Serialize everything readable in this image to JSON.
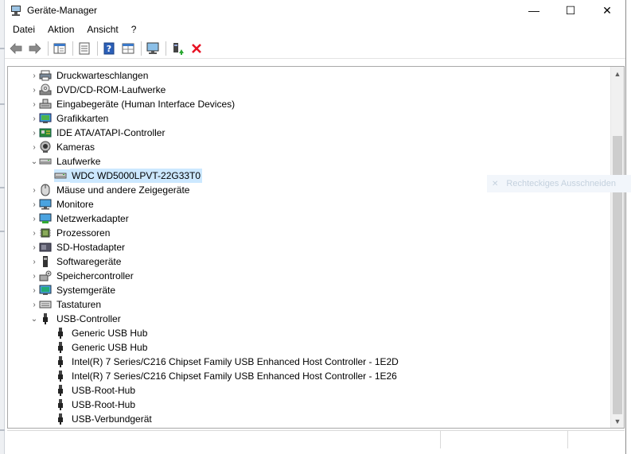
{
  "window": {
    "title": "Geräte-Manager",
    "controls": {
      "minimize": "—",
      "maximize": "☐",
      "close": "✕"
    }
  },
  "menu": [
    "Datei",
    "Aktion",
    "Ansicht",
    "?"
  ],
  "toolbar": {
    "buttons": [
      "back-icon",
      "forward-icon",
      "properties-pane-icon",
      "list-view-icon",
      "help-icon",
      "grid-view-icon",
      "monitor-scan-icon",
      "update-driver-icon",
      "uninstall-icon"
    ]
  },
  "tree": {
    "items": [
      {
        "label": "Druckwarteschlangen",
        "level": 0,
        "expander": "›",
        "icon": "printer-icon"
      },
      {
        "label": "DVD/CD-ROM-Laufwerke",
        "level": 0,
        "expander": "›",
        "icon": "disc-icon"
      },
      {
        "label": "Eingabegeräte (Human Interface Devices)",
        "level": 0,
        "expander": "›",
        "icon": "hid-icon"
      },
      {
        "label": "Grafikkarten",
        "level": 0,
        "expander": "›",
        "icon": "display-adapter-icon"
      },
      {
        "label": "IDE ATA/ATAPI-Controller",
        "level": 0,
        "expander": "›",
        "icon": "ide-controller-icon"
      },
      {
        "label": "Kameras",
        "level": 0,
        "expander": "›",
        "icon": "camera-icon"
      },
      {
        "label": "Laufwerke",
        "level": 0,
        "expander": "⌄",
        "icon": "drive-icon"
      },
      {
        "label": "WDC WD5000LPVT-22G33T0",
        "level": 1,
        "expander": "",
        "icon": "drive-icon",
        "selected": true
      },
      {
        "label": "Mäuse und andere Zeigegeräte",
        "level": 0,
        "expander": "›",
        "icon": "mouse-icon"
      },
      {
        "label": "Monitore",
        "level": 0,
        "expander": "›",
        "icon": "monitor-icon"
      },
      {
        "label": "Netzwerkadapter",
        "level": 0,
        "expander": "›",
        "icon": "network-icon"
      },
      {
        "label": "Prozessoren",
        "level": 0,
        "expander": "›",
        "icon": "processor-icon"
      },
      {
        "label": "SD-Hostadapter",
        "level": 0,
        "expander": "›",
        "icon": "sd-host-icon"
      },
      {
        "label": "Softwaregeräte",
        "level": 0,
        "expander": "›",
        "icon": "software-device-icon"
      },
      {
        "label": "Speichercontroller",
        "level": 0,
        "expander": "›",
        "icon": "storage-controller-icon"
      },
      {
        "label": "Systemgeräte",
        "level": 0,
        "expander": "›",
        "icon": "system-device-icon"
      },
      {
        "label": "Tastaturen",
        "level": 0,
        "expander": "›",
        "icon": "keyboard-icon"
      },
      {
        "label": "USB-Controller",
        "level": 0,
        "expander": "⌄",
        "icon": "usb-icon"
      },
      {
        "label": "Generic USB Hub",
        "level": 1,
        "expander": "",
        "icon": "usb-icon"
      },
      {
        "label": "Generic USB Hub",
        "level": 1,
        "expander": "",
        "icon": "usb-icon"
      },
      {
        "label": "Intel(R) 7 Series/C216 Chipset Family USB Enhanced Host Controller - 1E2D",
        "level": 1,
        "expander": "",
        "icon": "usb-icon"
      },
      {
        "label": "Intel(R) 7 Series/C216 Chipset Family USB Enhanced Host Controller - 1E26",
        "level": 1,
        "expander": "",
        "icon": "usb-icon"
      },
      {
        "label": "USB-Root-Hub",
        "level": 1,
        "expander": "",
        "icon": "usb-icon"
      },
      {
        "label": "USB-Root-Hub",
        "level": 1,
        "expander": "",
        "icon": "usb-icon"
      },
      {
        "label": "USB-Verbundgerät",
        "level": 1,
        "expander": "",
        "icon": "usb-icon"
      }
    ]
  },
  "scrollbar": {
    "up": "▲",
    "down": "▼"
  },
  "overlay": {
    "label": "Rechteckiges Ausschneiden",
    "icon": "close-icon",
    "glyph": "✕"
  },
  "colors": {
    "selection": "#cce8ff",
    "close_red": "#e81123",
    "accent_blue": "#2b6cb3"
  }
}
